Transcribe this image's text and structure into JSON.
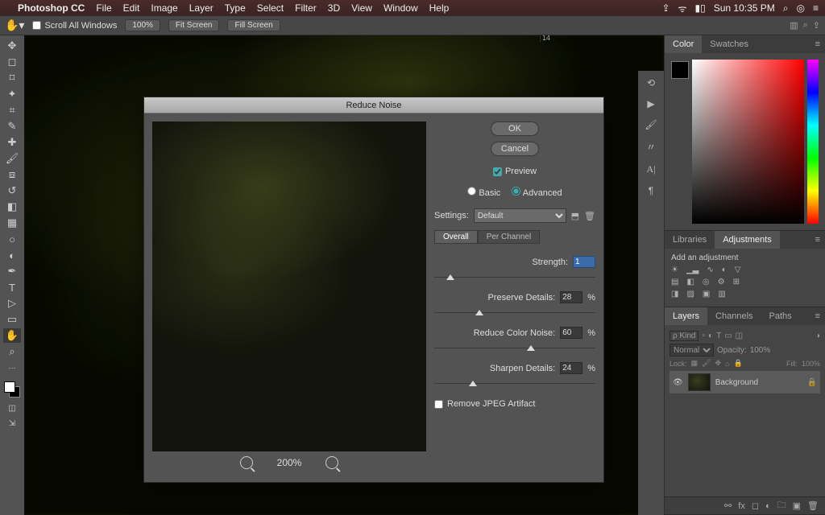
{
  "menubar": {
    "apple": "",
    "app": "Photoshop CC",
    "items": [
      "File",
      "Edit",
      "Image",
      "Layer",
      "Type",
      "Select",
      "Filter",
      "3D",
      "View",
      "Window",
      "Help"
    ],
    "status_time": "Sun 10:35 PM"
  },
  "options": {
    "scroll_all": "Scroll All Windows",
    "zoom": "100%",
    "fit_screen": "Fit Screen",
    "fill_screen": "Fill Screen"
  },
  "ruler_mark": "14",
  "tools": [
    "move",
    "marquee",
    "lasso",
    "wand",
    "crop",
    "eyedrop",
    "heal",
    "brush",
    "stamp",
    "history",
    "eraser",
    "gradient",
    "blur",
    "dodge",
    "pen",
    "type",
    "path",
    "shape",
    "hand",
    "zoom"
  ],
  "dialog": {
    "title": "Reduce Noise",
    "ok": "OK",
    "cancel": "Cancel",
    "preview": "Preview",
    "basic": "Basic",
    "advanced": "Advanced",
    "mode": "advanced",
    "settings_label": "Settings:",
    "settings_value": "Default",
    "sub_overall": "Overall",
    "sub_per_channel": "Per Channel",
    "strength_label": "Strength:",
    "strength_value": "1",
    "preserve_label": "Preserve Details:",
    "preserve_value": "28",
    "reduce_label": "Reduce Color Noise:",
    "reduce_value": "60",
    "sharpen_label": "Sharpen Details:",
    "sharpen_value": "24",
    "percent": "%",
    "jpeg": "Remove JPEG Artifact",
    "zoom_pct": "200%"
  },
  "panels": {
    "color": {
      "tab_color": "Color",
      "tab_swatches": "Swatches"
    },
    "libs": {
      "tab_libraries": "Libraries",
      "tab_adjust": "Adjustments",
      "hint": "Add an adjustment"
    },
    "layers": {
      "tab_layers": "Layers",
      "tab_channels": "Channels",
      "tab_paths": "Paths",
      "kind": "Kind",
      "blend": "Normal",
      "opacity_label": "Opacity:",
      "opacity_val": "100%",
      "lock": "Lock:",
      "fill_label": "Fill:",
      "fill_val": "100%",
      "layer_name": "Background"
    }
  }
}
